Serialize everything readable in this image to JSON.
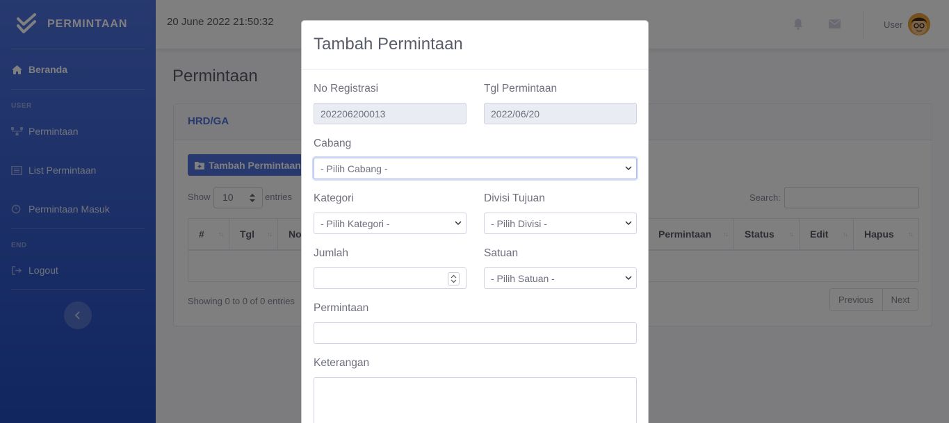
{
  "sidebar": {
    "brand": "PERMINTAAN",
    "items": [
      {
        "label": "Beranda",
        "icon": "home-icon"
      },
      {
        "label": "Permintaan",
        "icon": "sitemap-icon"
      },
      {
        "label": "List Permintaan",
        "icon": "list-icon"
      },
      {
        "label": "Permintaan Masuk",
        "icon": "clock-icon"
      },
      {
        "label": "Logout",
        "icon": "logout-icon"
      }
    ],
    "headings": [
      "USER",
      "END"
    ]
  },
  "topbar": {
    "datetime": "20 June 2022 21:50:32",
    "user_name": "User"
  },
  "page": {
    "title": "Permintaan",
    "card_title": "HRD/GA",
    "add_button": "Tambah Permintaan",
    "show_label": "Show",
    "page_length": "10",
    "entries_label": "entries",
    "search_label": "Search:",
    "columns": [
      "#",
      "Tgl",
      "No.",
      "Permintaan",
      "Status",
      "Edit",
      "Hapus"
    ],
    "info": "Showing 0 to 0 of 0 entries",
    "prev": "Previous",
    "next": "Next"
  },
  "modal": {
    "title": "Tambah Permintaan",
    "no_registrasi_label": "No Registrasi",
    "no_registrasi_value": "202206200013",
    "tgl_label": "Tgl Permintaan",
    "tgl_value": "2022/06/20",
    "cabang_label": "Cabang",
    "cabang_value": "- Pilih Cabang -",
    "kategori_label": "Kategori",
    "kategori_value": "- Pilih Kategori -",
    "divisi_label": "Divisi Tujuan",
    "divisi_value": "- Pilih Divisi -",
    "jumlah_label": "Jumlah",
    "satuan_label": "Satuan",
    "satuan_value": "- Pilih Satuan -",
    "permintaan_label": "Permintaan",
    "keterangan_label": "Keterangan"
  },
  "colors": {
    "primary": "#4e73df",
    "sidebar_end": "#224abe"
  }
}
